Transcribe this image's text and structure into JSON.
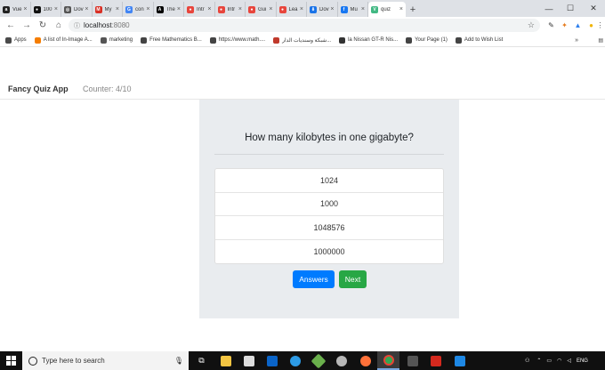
{
  "browser": {
    "tabs": [
      {
        "label": "Vue",
        "icon": "amazon-icon",
        "color": "#222222",
        "glyph": "a"
      },
      {
        "label": "100",
        "icon": "github-icon",
        "color": "#111111",
        "glyph": "●"
      },
      {
        "label": "Dov",
        "icon": "globe-icon",
        "color": "#555555",
        "glyph": "◎"
      },
      {
        "label": "My",
        "icon": "gmail-icon",
        "color": "#d93025",
        "glyph": "M"
      },
      {
        "label": "con",
        "icon": "google-icon",
        "color": "#4285f4",
        "glyph": "G"
      },
      {
        "label": "The",
        "icon": "black-square-icon",
        "color": "#000000",
        "glyph": "A"
      },
      {
        "label": "Intr",
        "icon": "red-circle-icon",
        "color": "#e8453c",
        "glyph": "●"
      },
      {
        "label": "Intr",
        "icon": "red-circle-icon",
        "color": "#e8453c",
        "glyph": "●"
      },
      {
        "label": "Gui",
        "icon": "red-circle-icon",
        "color": "#e8453c",
        "glyph": "●"
      },
      {
        "label": "Lea",
        "icon": "red-circle-icon",
        "color": "#e8453c",
        "glyph": "●"
      },
      {
        "label": "Dov",
        "icon": "download-icon",
        "color": "#1a73e8",
        "glyph": "⬇"
      },
      {
        "label": "Mu",
        "icon": "facebook-icon",
        "color": "#1877f2",
        "glyph": "f"
      },
      {
        "label": "quiz",
        "icon": "vue-icon",
        "color": "#41b883",
        "glyph": "V",
        "active": true
      }
    ],
    "url_host": "localhost",
    "url_port": ":8080",
    "bookmarks": [
      {
        "label": "Apps",
        "icon": "apps-grid-icon",
        "color": "#4a4a4a"
      },
      {
        "label": "A list of In-Image A...",
        "icon": "blogger-icon",
        "color": "#f57d00"
      },
      {
        "label": "marketing",
        "icon": "marketing-icon",
        "color": "#555555"
      },
      {
        "label": "Free Mathematics B...",
        "icon": "globe-icon",
        "color": "#444444"
      },
      {
        "label": "https://www.math....",
        "icon": "globe-icon",
        "color": "#444444"
      },
      {
        "label": "شبكة وسنديات الدار...",
        "icon": "home-icon",
        "color": "#c0392b"
      },
      {
        "label": "la Nissan GT-R Nis...",
        "icon": "page-icon",
        "color": "#333333"
      },
      {
        "label": "Your Page (1)",
        "icon": "globe-icon",
        "color": "#444444"
      },
      {
        "label": "Add to Wish List",
        "icon": "globe-icon",
        "color": "#444444"
      }
    ]
  },
  "app": {
    "brand": "Fancy Quiz App",
    "counter": "Counter: 4/10",
    "question": "How many kilobytes in one gigabyte?",
    "answers": [
      "1024",
      "1000",
      "1048576",
      "1000000"
    ],
    "answers_button": "Answers",
    "next_button": "Next"
  },
  "taskbar": {
    "search_placeholder": "Type here to search",
    "language": "ENG"
  },
  "colors": {
    "primary": "#007bff",
    "success": "#28a745",
    "card": "#e9ecef"
  }
}
